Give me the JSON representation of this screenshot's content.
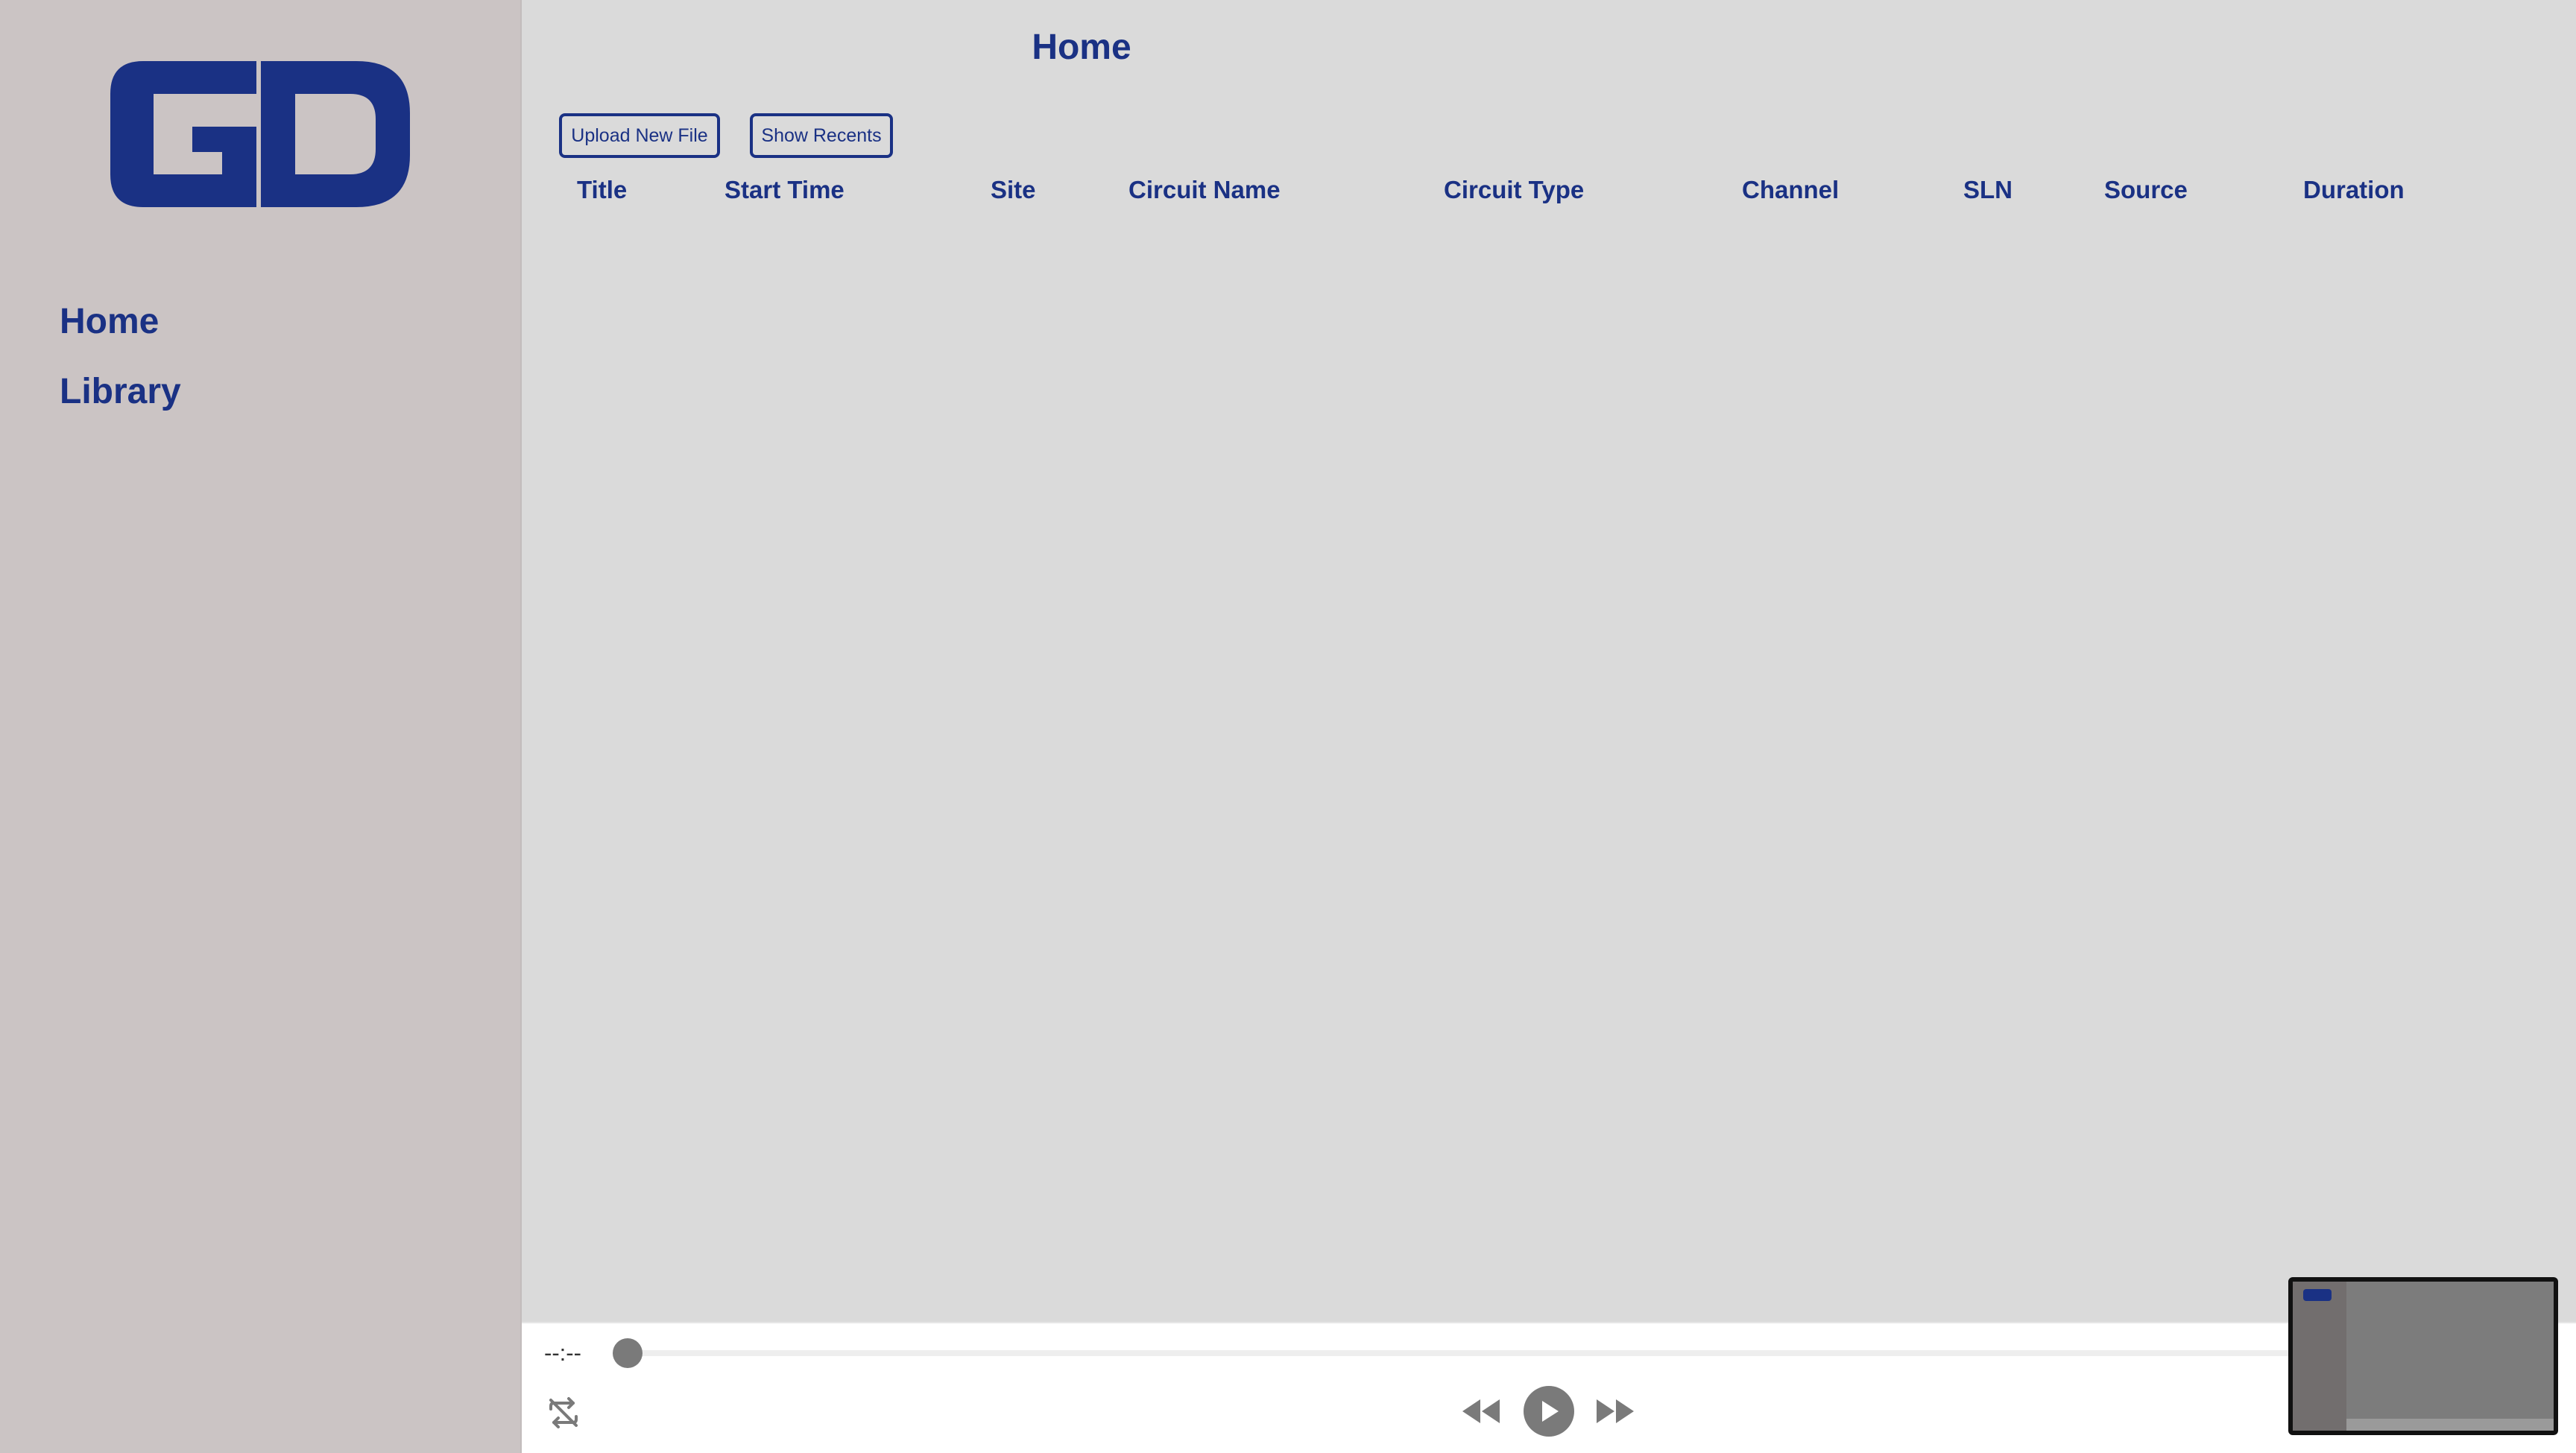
{
  "sidebar": {
    "logo_text": "GD",
    "items": [
      {
        "label": "Home"
      },
      {
        "label": "Library"
      }
    ]
  },
  "main": {
    "title": "Home",
    "buttons": {
      "upload": "Upload New File",
      "recents": "Show Recents"
    },
    "columns": [
      "Title",
      "Start Time",
      "Site",
      "Circuit Name",
      "Circuit Type",
      "Channel",
      "SLN",
      "Source",
      "Duration"
    ]
  },
  "player": {
    "time": "--:--",
    "progress": 0,
    "icons": [
      "repeat-off-icon",
      "rewind-icon",
      "play-icon",
      "fast-forward-icon"
    ]
  },
  "colors": {
    "brand": "#1a3184",
    "sidebar_bg": "#cbc4c4",
    "main_bg": "#dadada",
    "control_gray": "#7a7a7a"
  }
}
